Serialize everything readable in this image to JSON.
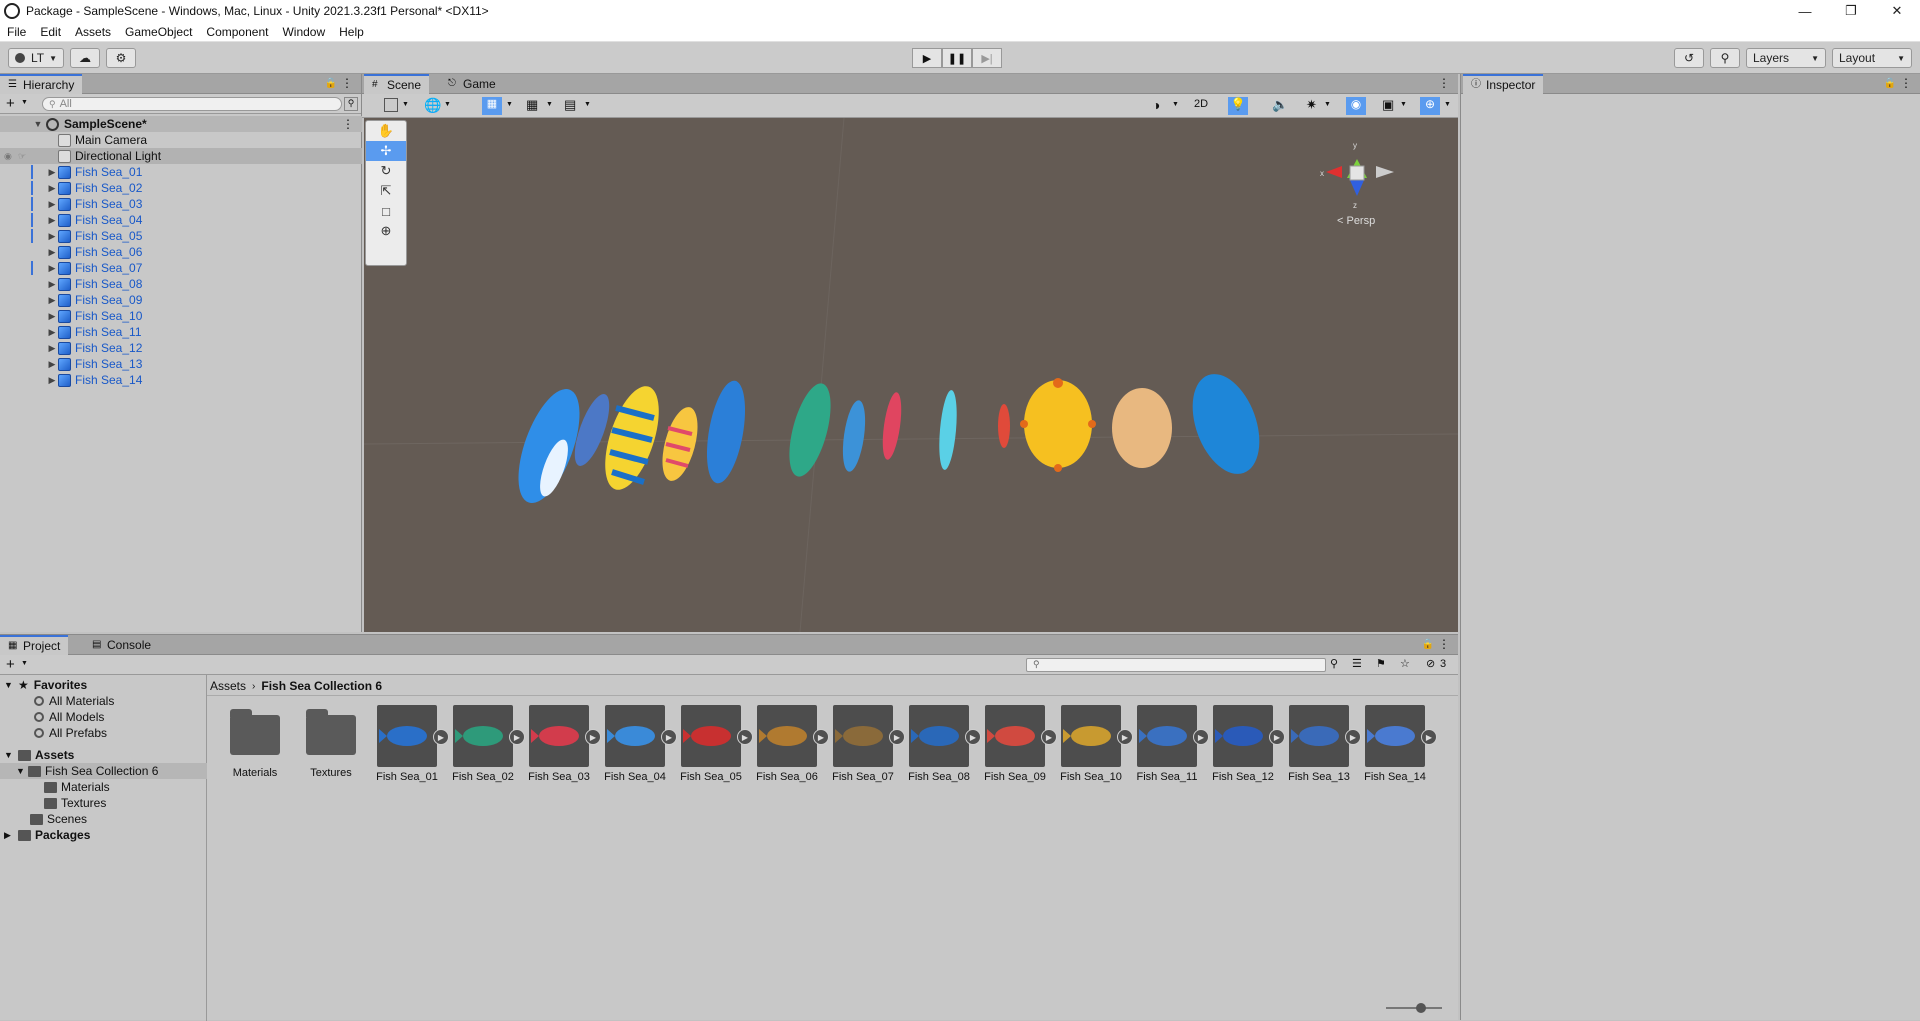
{
  "window": {
    "title": "Package - SampleScene - Windows, Mac, Linux - Unity 2021.3.23f1 Personal* <DX11>"
  },
  "menu": [
    "File",
    "Edit",
    "Assets",
    "GameObject",
    "Component",
    "Window",
    "Help"
  ],
  "toolbar": {
    "account": "LT",
    "layers": "Layers",
    "layout": "Layout"
  },
  "hierarchy": {
    "tab": "Hierarchy",
    "search_placeholder": "All",
    "scene": "SampleScene*",
    "items": [
      "Main Camera",
      "Directional Light",
      "Fish Sea_01",
      "Fish Sea_02",
      "Fish Sea_03",
      "Fish Sea_04",
      "Fish Sea_05",
      "Fish Sea_06",
      "Fish Sea_07",
      "Fish Sea_08",
      "Fish Sea_09",
      "Fish Sea_10",
      "Fish Sea_11",
      "Fish Sea_12",
      "Fish Sea_13",
      "Fish Sea_14"
    ]
  },
  "scene": {
    "tabs": [
      "Scene",
      "Game"
    ],
    "mode_2d": "2D",
    "camera_label": "< Persp",
    "axis_labels": {
      "x": "x",
      "y": "y",
      "z": "z"
    },
    "colors": {
      "background": "#645b54"
    }
  },
  "inspector": {
    "tab": "Inspector"
  },
  "project": {
    "tabs": [
      "Project",
      "Console"
    ],
    "favorites_label": "Favorites",
    "favorites": [
      "All Materials",
      "All Models",
      "All Prefabs"
    ],
    "assets_label": "Assets",
    "tree": [
      "Fish Sea Collection 6",
      "Materials",
      "Textures",
      "Scenes"
    ],
    "packages_label": "Packages",
    "breadcrumb": [
      "Assets",
      "Fish Sea Collection 6"
    ],
    "hidden_count": "3",
    "folders": [
      "Materials",
      "Textures"
    ],
    "assets": [
      "Fish Sea_01",
      "Fish Sea_02",
      "Fish Sea_03",
      "Fish Sea_04",
      "Fish Sea_05",
      "Fish Sea_06",
      "Fish Sea_07",
      "Fish Sea_08",
      "Fish Sea_09",
      "Fish Sea_10",
      "Fish Sea_11",
      "Fish Sea_12",
      "Fish Sea_13",
      "Fish Sea_14"
    ]
  }
}
